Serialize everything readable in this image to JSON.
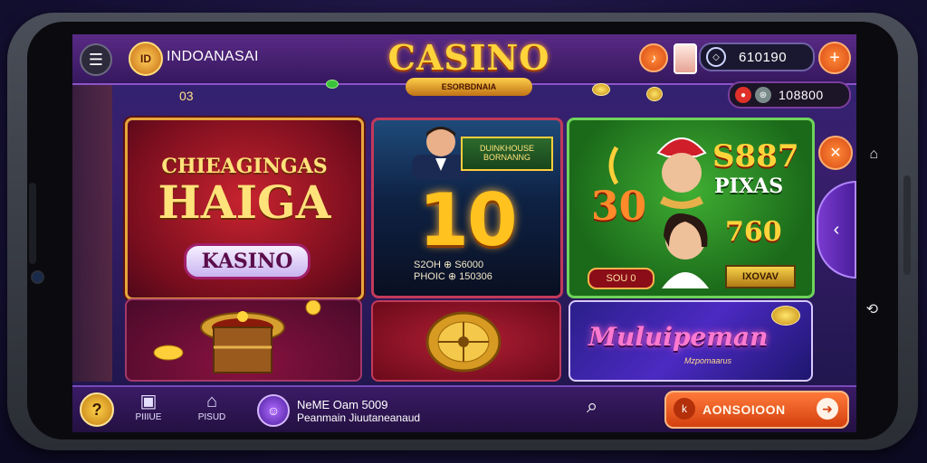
{
  "header": {
    "brand": "INDOANASAI",
    "logo_text": "ID",
    "casino_title": "CASINO",
    "casino_subtitle": "ESORBDNAIA",
    "counter": "03",
    "balance_primary": "610190",
    "balance_secondary": "108800"
  },
  "tiles": {
    "featured": {
      "line1": "CHIEAGINGAS",
      "line2": "HAIGA",
      "ribbon": "KASINO"
    },
    "jackpot": {
      "banner": "DUINKHOUSE BORNANNG",
      "big_number": "10",
      "stat1": "S2OH ⊕ S6000",
      "stat2": "PHOIC ⊕ 150306"
    },
    "live": {
      "top_number": "S887",
      "label": "PIXAS",
      "left_number": "30",
      "right_number": "760",
      "button": "SOU 0",
      "plate": "IXOVAV"
    },
    "multi": {
      "title": "Muluipeman",
      "subtitle": "Mzpomaarus"
    }
  },
  "bottom_nav": [
    {
      "icon": "box-icon",
      "label": "PIIIUE"
    },
    {
      "icon": "house-icon",
      "label": "PISUD"
    }
  ],
  "promo": {
    "line1": "NeME Oam 5009",
    "line2": "Peanmain Jiuutaneanaud"
  },
  "cta": {
    "label": "AONSOIOON"
  },
  "colors": {
    "accent": "#ff7a3a",
    "gold": "#ffd43b",
    "purple": "#5a2a86"
  }
}
